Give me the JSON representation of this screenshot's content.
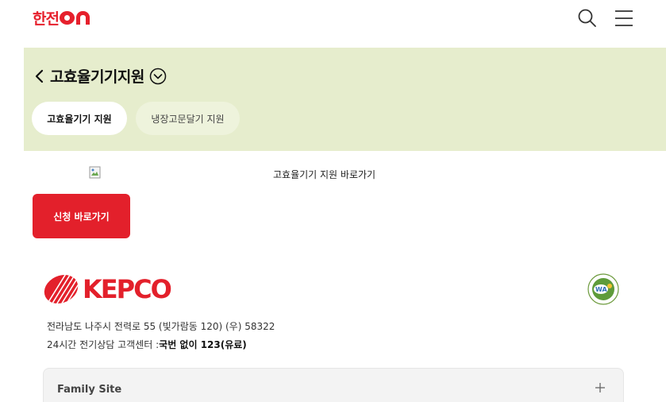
{
  "header": {
    "logo_text": "한전",
    "logo_on": "ON",
    "search_icon": "search-icon",
    "menu_icon": "hamburger-menu-icon"
  },
  "section": {
    "title": "고효율기기지원",
    "tabs": [
      {
        "label": "고효율기기 지원",
        "active": true
      },
      {
        "label": "냉장고문달기 지원",
        "active": false
      }
    ],
    "band_color": "#e6edcd"
  },
  "banner": {
    "image_alt": "고효율기기 지원 바로가기"
  },
  "apply_button": {
    "label": "신청 바로가기",
    "color": "#e3202b"
  },
  "footer": {
    "brand": "KEPCO",
    "address": "전라남도 나주시 전력로 55 (빛가람동 120) (우) 58322",
    "callcenter_prefix": "24시간 전기상담 고객센터 :",
    "callcenter_number": "국번 없이 123(유료)",
    "family_site": "Family Site"
  }
}
